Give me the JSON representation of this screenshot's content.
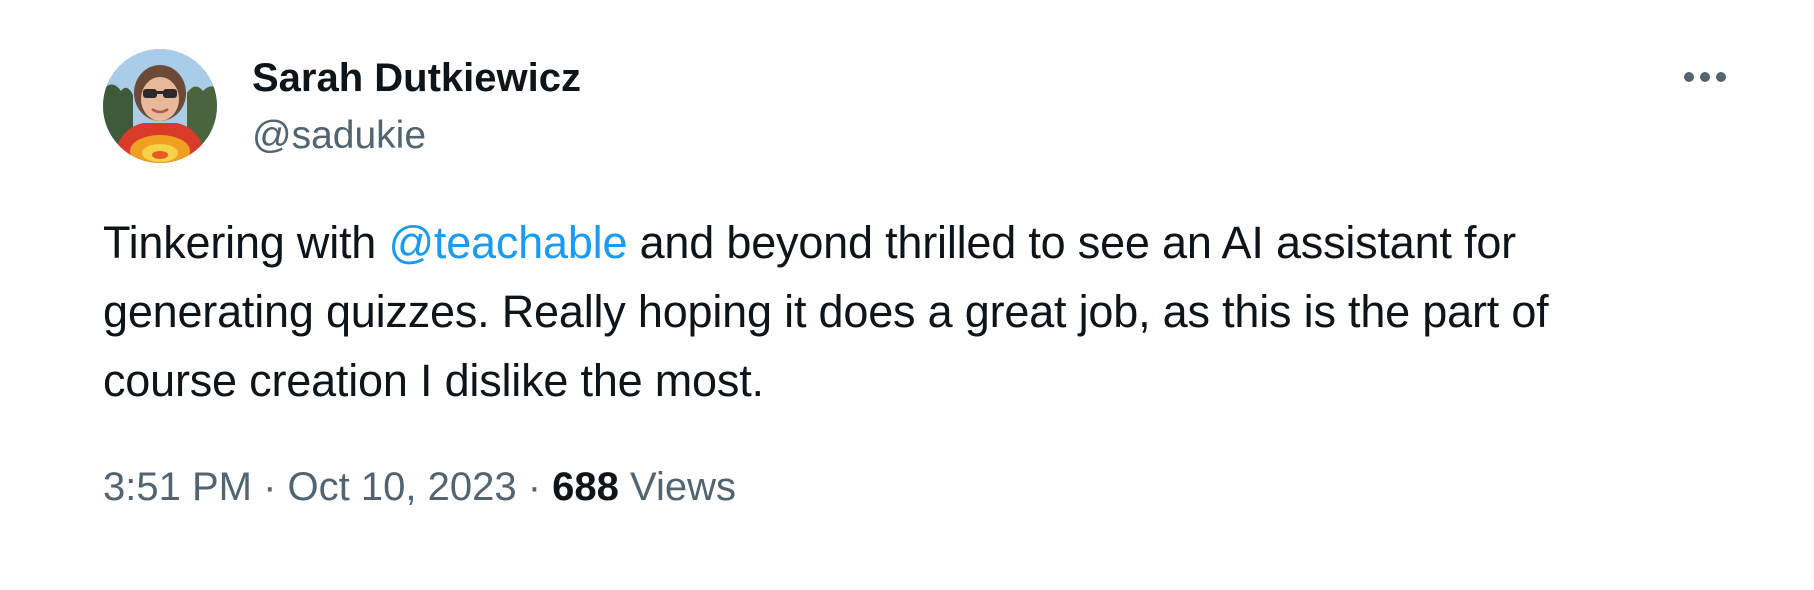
{
  "author": {
    "display_name": "Sarah Dutkiewicz",
    "handle": "@sadukie"
  },
  "tweet": {
    "lines": [
      {
        "before": "Tinkering with ",
        "mention": "@teachable",
        "after": " and beyond thrilled to see an AI assistant for"
      },
      {
        "text": "generating quizzes. Really hoping it does a great job, as this is the part of"
      },
      {
        "text": "course creation I dislike the most."
      }
    ],
    "time": "3:51 PM",
    "separator": "·",
    "date": "Oct 10, 2023",
    "views_count": "688",
    "views_label": "Views"
  },
  "icons": {
    "more": "more-horizontal-icon"
  },
  "colors": {
    "text_primary": "#0f1419",
    "text_secondary": "#536471",
    "link": "#1d9bf0",
    "background": "#ffffff"
  }
}
